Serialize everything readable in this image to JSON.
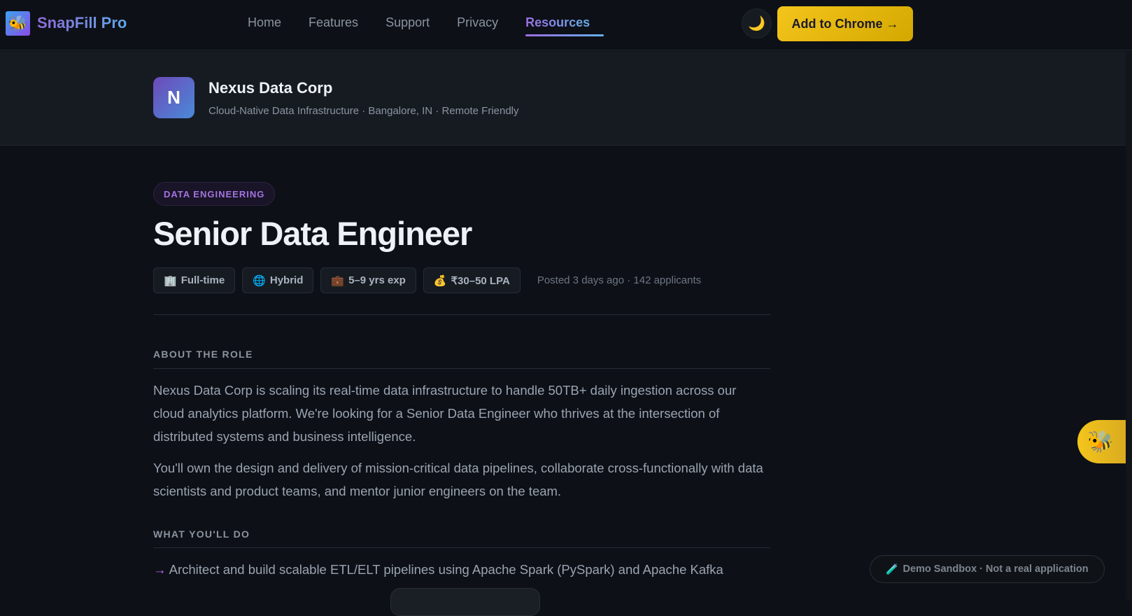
{
  "nav": {
    "brand": "SnapFill Pro",
    "links": [
      "Home",
      "Features",
      "Support",
      "Privacy",
      "Resources"
    ],
    "active": "Resources",
    "theme_icon": "moon-icon",
    "cta": "Add to Chrome →"
  },
  "company": {
    "initial": "N",
    "name": "Nexus Data Corp",
    "subtitle": "Cloud-Native Data Infrastructure · Bangalore, IN · Remote Friendly"
  },
  "job": {
    "category": "DATA ENGINEERING",
    "title": "Senior Data Engineer",
    "chips": [
      {
        "icon": "🏢",
        "label": "Full-time"
      },
      {
        "icon": "🌐",
        "label": "Hybrid"
      },
      {
        "icon": "💼",
        "label": "5–9 yrs exp"
      },
      {
        "icon": "💰",
        "label": "₹30–50 LPA"
      }
    ],
    "meta": "Posted 3 days ago · 142 applicants"
  },
  "about": {
    "heading": "ABOUT THE ROLE",
    "paragraphs": [
      "Nexus Data Corp is scaling its real-time data infrastructure to handle 50TB+ daily ingestion across our cloud analytics platform. We're looking for a Senior Data Engineer who thrives at the intersection of distributed systems and business intelligence.",
      "You'll own the design and delivery of mission-critical data pipelines, collaborate cross-functionally with data scientists and product teams, and mentor junior engineers on the team."
    ]
  },
  "todo": {
    "heading": "WHAT YOU'LL DO",
    "arrow": "→",
    "items": [
      "Architect and build scalable ETL/ELT pipelines using Apache Spark (PySpark) and Apache Kafka"
    ]
  },
  "sandbox": {
    "icon": "🧪",
    "label": "Demo Sandbox · Not a real application"
  },
  "colors": {
    "accent": "#f4c51c",
    "purple": "#a374e0",
    "bg": "#0d1017"
  }
}
